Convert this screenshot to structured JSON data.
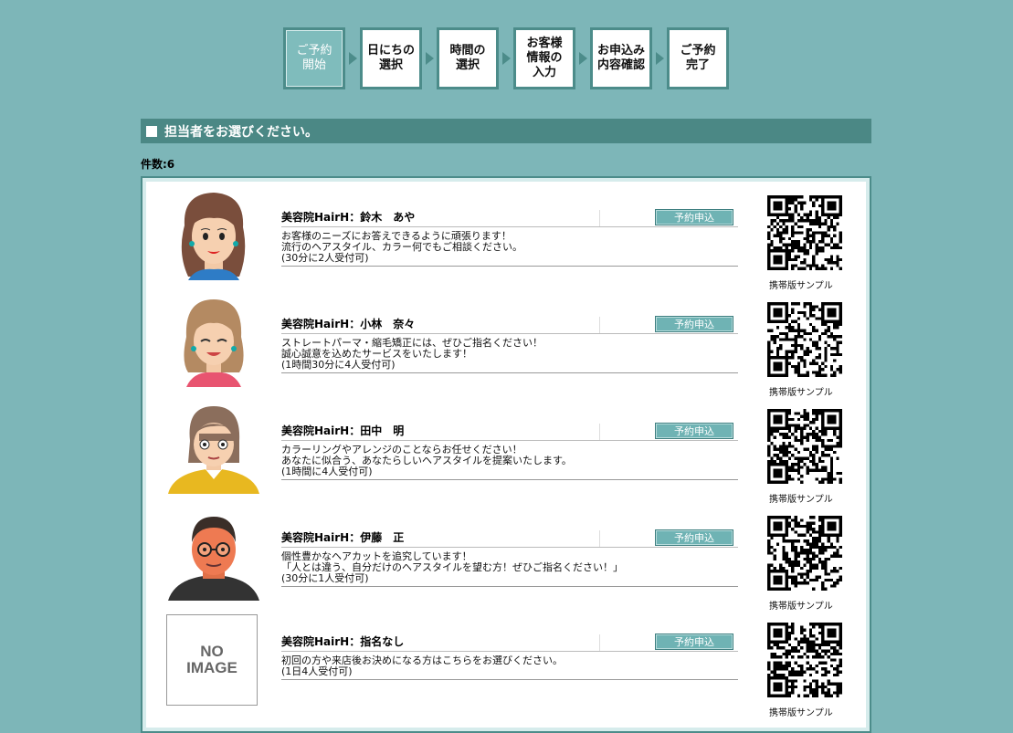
{
  "steps": [
    {
      "label": "ご予約\n開始",
      "active": true
    },
    {
      "label": "日にちの\n選択",
      "active": false
    },
    {
      "label": "時間の\n選択",
      "active": false
    },
    {
      "label": "お客様\n情報の\n入力",
      "active": false
    },
    {
      "label": "お申込み\n内容確認",
      "active": false
    },
    {
      "label": "ご予約\n完了",
      "active": false
    }
  ],
  "section_title": "担当者をお選びください。",
  "count_label": "件数:6",
  "reserve_label": "予約申込",
  "qr_label": "携帯版サンプル",
  "no_image": {
    "line1": "NO",
    "line2": "IMAGE"
  },
  "staff": [
    {
      "name": "美容院HairH：鈴木　あや",
      "desc": "お客様のニーズにお答えできるように頑張ります！\n流行のヘアスタイル、カラー何でもご相談ください。\n(30分に2人受付可)",
      "avatar": "woman-long-hair"
    },
    {
      "name": "美容院HairH：小林　奈々",
      "desc": "ストレートパーマ・縮毛矯正には、ぜひご指名ください！\n誠心誠意を込めたサービスをいたします！\n(1時間30分に4人受付可)",
      "avatar": "woman-smiling"
    },
    {
      "name": "美容院HairH：田中　明",
      "desc": "カラーリングやアレンジのことならお任せください！\nあなたに似合う、あなたらしいヘアスタイルを提案いたします。\n(1時間に4人受付可)",
      "avatar": "woman-yellow-shirt"
    },
    {
      "name": "美容院HairH：伊藤　正",
      "desc": "個性豊かなヘアカットを追究しています！\n「人とは違う、自分だけのヘアスタイルを望む方！ぜひご指名ください！」\n(30分に1人受付可)",
      "avatar": "man-glasses"
    },
    {
      "name": "美容院HairH：指名なし",
      "desc": "初回の方や来店後お決めになる方はこちらをお選びください。\n(1日4人受付可)",
      "avatar": "no-image"
    }
  ],
  "colors": {
    "background": "#7db6b8",
    "accent": "#4c8c8a",
    "button": "#6fb3b4"
  }
}
